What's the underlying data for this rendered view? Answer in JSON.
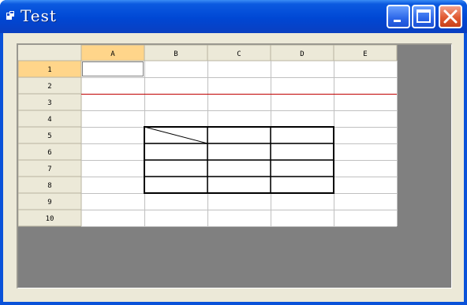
{
  "window": {
    "title": "Test"
  },
  "sheet": {
    "columns": [
      "A",
      "B",
      "C",
      "D",
      "E"
    ],
    "rows": [
      "1",
      "2",
      "3",
      "4",
      "5",
      "6",
      "7",
      "8",
      "9",
      "10"
    ],
    "selected_cell": "A1",
    "selected_column": "A",
    "selected_row": "1",
    "colors": {
      "header_bg": "#ece9d8",
      "header_selected_bg": "#ffd58a",
      "grid_line": "#c0c0c0",
      "red_line": "#c00000",
      "background": "#808080"
    }
  }
}
